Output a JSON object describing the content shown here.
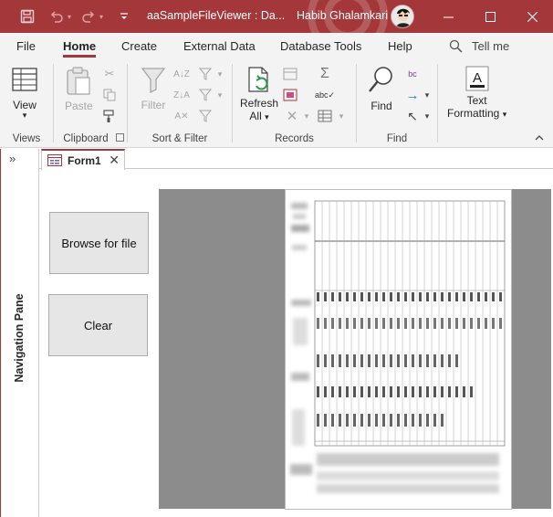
{
  "window": {
    "title": "aaSampleFileViewer : Da...",
    "user": "Habib Ghalamkari",
    "colors": {
      "accent": "#a4373a",
      "ribbon_bg": "#f3f3f3",
      "viewer_bg": "#8c8c8c"
    }
  },
  "menu": {
    "tabs": [
      "File",
      "Home",
      "Create",
      "External Data",
      "Database Tools",
      "Help"
    ],
    "active": "Home",
    "tell_me": "Tell me"
  },
  "ribbon": {
    "views": {
      "view_label": "View",
      "group_label": "Views"
    },
    "clipboard": {
      "paste_label": "Paste",
      "group_label": "Clipboard"
    },
    "sort_filter": {
      "filter_label": "Filter",
      "group_label": "Sort & Filter"
    },
    "records": {
      "refresh_label": "Refresh",
      "refresh_sub": "All",
      "group_label": "Records"
    },
    "find": {
      "find_label": "Find",
      "group_label": "Find"
    },
    "text_formatting": {
      "label_line1": "Text",
      "label_line2": "Formatting"
    }
  },
  "nav_pane": {
    "label": "Navigation Pane"
  },
  "document": {
    "tab_label": "Form1"
  },
  "form": {
    "browse_button": "Browse for file",
    "clear_button": "Clear"
  }
}
